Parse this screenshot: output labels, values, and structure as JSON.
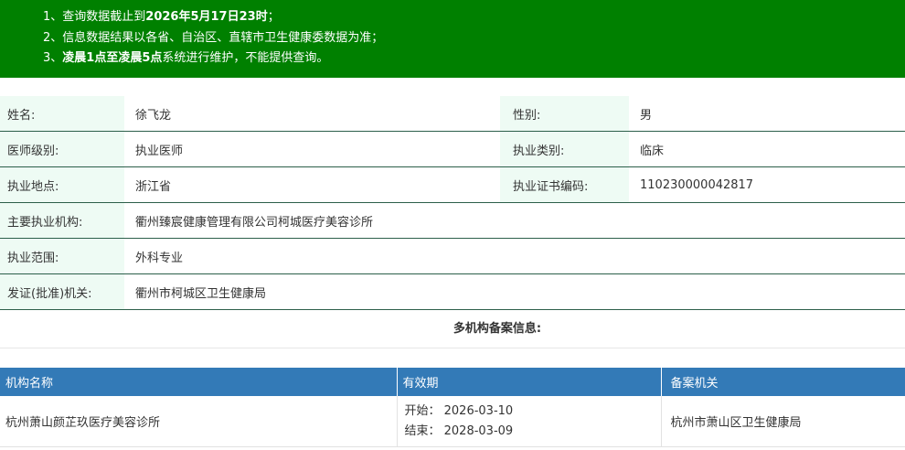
{
  "notice": {
    "line1_prefix": "1、查询数据截止到",
    "line1_bold": "2026年5月17日23时",
    "line1_suffix": "；",
    "line2": "2、信息数据结果以各省、自治区、直辖市卫生健康委数据为准；",
    "line3_prefix": "3、",
    "line3_bold": "凌晨1点至凌晨5点",
    "line3_suffix": "系统进行维护，不能提供查询。"
  },
  "info": {
    "name_label": "姓名:",
    "name_value": "徐飞龙",
    "gender_label": "性别:",
    "gender_value": "男",
    "level_label": "医师级别:",
    "level_value": "执业医师",
    "category_label": "执业类别:",
    "category_value": "临床",
    "location_label": "执业地点:",
    "location_value": "浙江省",
    "cert_label": "执业证书编码:",
    "cert_value": "110230000042817",
    "org_label": "主要执业机构:",
    "org_value": "衢州臻宸健康管理有限公司柯城医疗美容诊所",
    "scope_label": "执业范围:",
    "scope_value": "外科专业",
    "issuer_label": "发证(批准)机关:",
    "issuer_value": "衢州市柯城区卫生健康局"
  },
  "multi": {
    "title": "多机构备案信息:",
    "headers": {
      "institution": "机构名称",
      "validity": "有效期",
      "registrar": "备案机关"
    },
    "rows": [
      {
        "institution": "杭州萧山颜芷玖医疗美容诊所",
        "start": "开始：  2026-03-10",
        "end": "结束：  2028-03-09",
        "registrar": "杭州市萧山区卫生健康局"
      }
    ]
  },
  "colors": {
    "notice_bg": "#008000",
    "label_bg": "#eefbf4",
    "row_border": "#2c5f4a",
    "table_header_bg": "#337ab7"
  }
}
